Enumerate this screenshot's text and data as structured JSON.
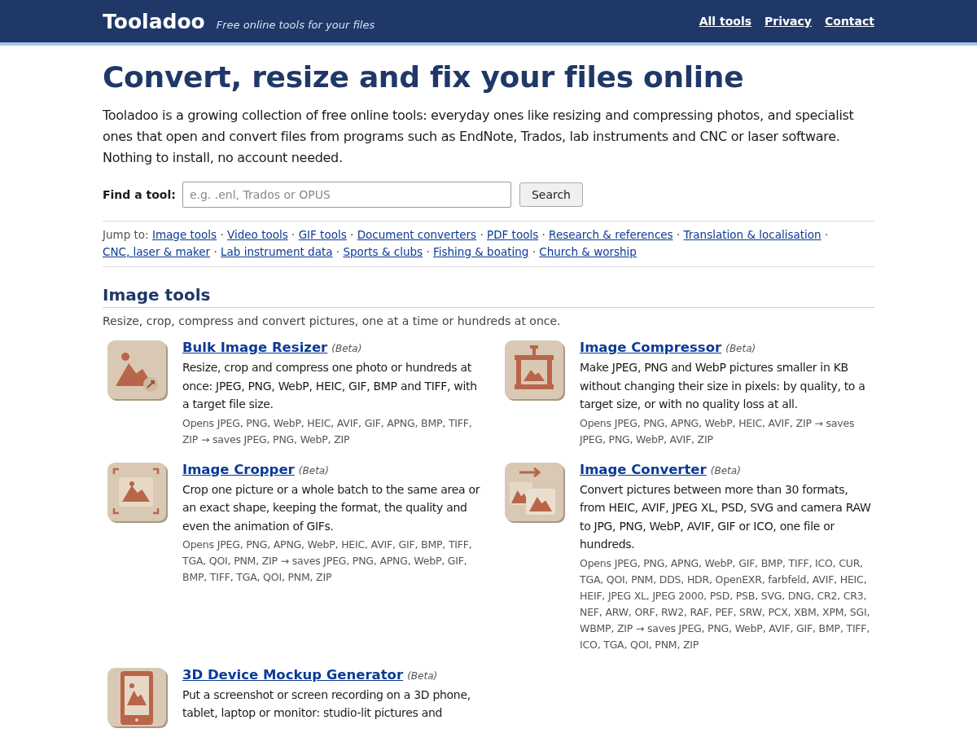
{
  "header": {
    "brand": "Tooladoo",
    "tagline": "Free online tools for your files",
    "nav": [
      {
        "label": "All tools"
      },
      {
        "label": "Privacy"
      },
      {
        "label": "Contact"
      }
    ]
  },
  "headline": "Convert, resize and fix your files online",
  "intro": "Tooladoo is a growing collection of free online tools: everyday ones like resizing and compressing photos, and specialist ones that open and convert files from programs such as EndNote, Trados, lab instruments and CNC or laser software. Nothing to install, no account needed.",
  "search": {
    "label": "Find a tool:",
    "placeholder": "e.g. .enl, Trados or OPUS",
    "button": "Search"
  },
  "jump": {
    "label": "Jump to:",
    "separator": "·",
    "links": [
      "Image tools",
      "Video tools",
      "GIF tools",
      "Document converters",
      "PDF tools",
      "Research & references",
      "Translation & localisation",
      "CNC, laser & maker",
      "Lab instrument data",
      "Sports & clubs",
      "Fishing & boating",
      "Church & worship"
    ]
  },
  "section": {
    "title": "Image tools",
    "subtitle": "Resize, crop, compress and convert pictures, one at a time or hundreds at once.",
    "tools": [
      {
        "kind": "resize",
        "name": "Bulk Image Resizer",
        "badge": "(Beta)",
        "description": "Resize, crop and compress one photo or hundreds at once: JPEG, PNG, WebP, HEIC, GIF, BMP and TIFF, with a target file size.",
        "formats": "Opens JPEG, PNG, WebP, HEIC, AVIF, GIF, APNG, BMP, TIFF, ZIP → saves JPEG, PNG, WebP, ZIP"
      },
      {
        "kind": "compress",
        "name": "Image Compressor",
        "badge": "(Beta)",
        "description": "Make JPEG, PNG and WebP pictures smaller in KB without changing their size in pixels: by quality, to a target size, or with no quality loss at all.",
        "formats": "Opens JPEG, PNG, APNG, WebP, HEIC, AVIF, ZIP → saves JPEG, PNG, WebP, AVIF, ZIP"
      },
      {
        "kind": "crop",
        "name": "Image Cropper",
        "badge": "(Beta)",
        "description": "Crop one picture or a whole batch to the same area or an exact shape, keeping the format, the quality and even the animation of GIFs.",
        "formats": "Opens JPEG, PNG, APNG, WebP, HEIC, AVIF, GIF, BMP, TIFF, TGA, QOI, PNM, ZIP → saves JPEG, PNG, APNG, WebP, GIF, BMP, TIFF, TGA, QOI, PNM, ZIP"
      },
      {
        "kind": "convert",
        "name": "Image Converter",
        "badge": "(Beta)",
        "description": "Convert pictures between more than 30 formats, from HEIC, AVIF, JPEG XL, PSD, SVG and camera RAW to JPG, PNG, WebP, AVIF, GIF or ICO, one file or hundreds.",
        "formats": "Opens JPEG, PNG, APNG, WebP, GIF, BMP, TIFF, ICO, CUR, TGA, QOI, PNM, DDS, HDR, OpenEXR, farbfeld, AVIF, HEIC, HEIF, JPEG XL, JPEG 2000, PSD, PSB, SVG, DNG, CR2, CR3, NEF, ARW, ORF, RW2, RAF, PEF, SRW, PCX, XBM, XPM, SGI, WBMP, ZIP → saves JPEG, PNG, WebP, AVIF, GIF, BMP, TIFF, ICO, TGA, QOI, PNM, ZIP"
      },
      {
        "kind": "mockup",
        "name": "3D Device Mockup Generator",
        "badge": "(Beta)",
        "description": "Put a screenshot or screen recording on a 3D phone, tablet, laptop or monitor: studio-lit pictures and"
      }
    ]
  }
}
